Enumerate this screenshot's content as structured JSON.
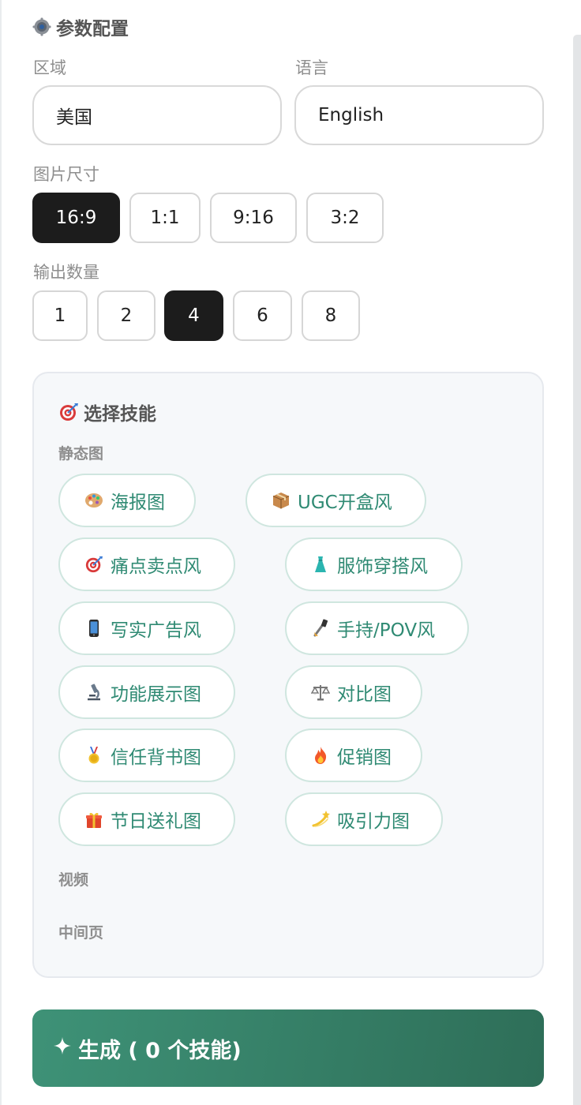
{
  "params": {
    "title": "参数配置",
    "title_icon": "gear-icon",
    "region": {
      "label": "区域",
      "value": "美国"
    },
    "language": {
      "label": "语言",
      "value": "English"
    },
    "image_size": {
      "label": "图片尺寸",
      "options": [
        "16:9",
        "1:1",
        "9:16",
        "3:2"
      ],
      "selected": "16:9"
    },
    "output_count": {
      "label": "输出数量",
      "options": [
        "1",
        "2",
        "4",
        "6",
        "8"
      ],
      "selected": "4"
    }
  },
  "skills": {
    "title": "选择技能",
    "title_icon": "target-icon",
    "static_label": "静态图",
    "items": [
      {
        "icon": "palette-icon",
        "label": "海报图"
      },
      {
        "icon": "package-icon",
        "label": "UGC开盒风"
      },
      {
        "icon": "target-icon",
        "label": "痛点卖点风"
      },
      {
        "icon": "dress-icon",
        "label": "服饰穿搭风"
      },
      {
        "icon": "phone-icon",
        "label": "写实广告风"
      },
      {
        "icon": "selfie-stick-icon",
        "label": "手持/POV风"
      },
      {
        "icon": "microscope-icon",
        "label": "功能展示图"
      },
      {
        "icon": "scales-icon",
        "label": "对比图"
      },
      {
        "icon": "medal-icon",
        "label": "信任背书图"
      },
      {
        "icon": "fire-icon",
        "label": "促销图"
      },
      {
        "icon": "gift-icon",
        "label": "节日送礼图"
      },
      {
        "icon": "dizzy-star-icon",
        "label": "吸引力图"
      }
    ],
    "video_label": "视频",
    "middle_page_label": "中间页"
  },
  "generate_button": {
    "icon": "sparkle-icon",
    "label": "生成 ( 0 个技能)"
  },
  "colors": {
    "selected_option": "#1c1c1c",
    "chip_text": "#2f8a73",
    "chip_border": "#cfe6df",
    "button_gradient_start": "#3e9277",
    "button_gradient_end": "#2e6e58"
  }
}
